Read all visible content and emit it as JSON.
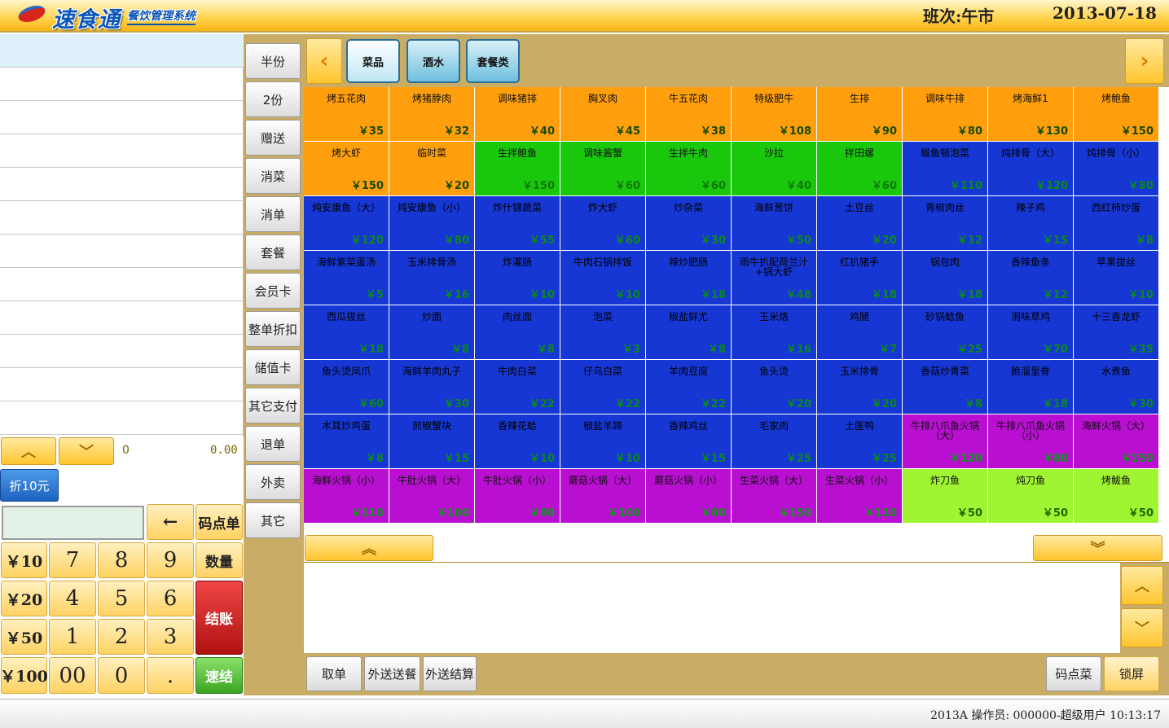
{
  "header": {
    "logo_text": "速食通",
    "logo_sub": "餐饮管理系统",
    "shift": "班次:午市",
    "date": "2013-07-18"
  },
  "summary": {
    "qty": "0",
    "amount": "0.00"
  },
  "discount_label": "折10元",
  "keypad": {
    "back": "←",
    "code_order": "码点单",
    "quantity": "数量",
    "checkout": "结账",
    "quick": "速结",
    "money": [
      "￥10",
      "￥20",
      "￥50",
      "￥100"
    ],
    "digits": [
      "7",
      "8",
      "9",
      "4",
      "5",
      "6",
      "1",
      "2",
      "3",
      "00",
      "0",
      "."
    ]
  },
  "side_buttons": [
    "半份",
    "2份",
    "赠送",
    "消菜",
    "消单",
    "套餐",
    "会员卡",
    "整单折扣",
    "储值卡",
    "其它支付",
    "退单",
    "外卖",
    "其它"
  ],
  "category_tabs": [
    "菜品",
    "酒水",
    "套餐类"
  ],
  "dishes": [
    {
      "name": "烤五花肉",
      "price": "￥35",
      "color": "orange"
    },
    {
      "name": "烤猪脖肉",
      "price": "￥32",
      "color": "orange"
    },
    {
      "name": "调味猪排",
      "price": "￥40",
      "color": "orange"
    },
    {
      "name": "胸叉肉",
      "price": "￥45",
      "color": "orange"
    },
    {
      "name": "牛五花肉",
      "price": "￥38",
      "color": "orange"
    },
    {
      "name": "特级肥牛",
      "price": "￥108",
      "color": "orange"
    },
    {
      "name": "生排",
      "price": "￥90",
      "color": "orange"
    },
    {
      "name": "调味牛排",
      "price": "￥80",
      "color": "orange"
    },
    {
      "name": "烤海鲜1",
      "price": "￥130",
      "color": "orange"
    },
    {
      "name": "烤鲍鱼",
      "price": "￥150",
      "color": "orange"
    },
    {
      "name": "烤大虾",
      "price": "￥150",
      "color": "orange"
    },
    {
      "name": "临时菜",
      "price": "￥20",
      "color": "orange"
    },
    {
      "name": "生拌鲍鱼",
      "price": "￥150",
      "color": "green"
    },
    {
      "name": "调味酱蟹",
      "price": "￥60",
      "color": "green"
    },
    {
      "name": "生拌牛肉",
      "price": "￥60",
      "color": "green"
    },
    {
      "name": "沙拉",
      "price": "￥40",
      "color": "green"
    },
    {
      "name": "拌田螺",
      "price": "￥60",
      "color": "green"
    },
    {
      "name": "鲅鱼顿泡菜",
      "price": "￥110",
      "color": "blue"
    },
    {
      "name": "炖排骨（大）",
      "price": "￥120",
      "color": "blue"
    },
    {
      "name": "炖排骨（小）",
      "price": "￥80",
      "color": "blue"
    },
    {
      "name": "炖安康鱼（大）",
      "price": "￥120",
      "color": "blue"
    },
    {
      "name": "炖安康鱼（小）",
      "price": "￥80",
      "color": "blue"
    },
    {
      "name": "炸什锦蔬菜",
      "price": "￥55",
      "color": "blue"
    },
    {
      "name": "炸大虾",
      "price": "￥60",
      "color": "blue"
    },
    {
      "name": "炒杂菜",
      "price": "￥30",
      "color": "blue"
    },
    {
      "name": "海鲜葱饼",
      "price": "￥50",
      "color": "blue"
    },
    {
      "name": "土豆丝",
      "price": "￥20",
      "color": "blue"
    },
    {
      "name": "青椒肉丝",
      "price": "￥12",
      "color": "blue"
    },
    {
      "name": "辣子鸡",
      "price": "￥15",
      "color": "blue"
    },
    {
      "name": "西红柿炒蛋",
      "price": "￥8",
      "color": "blue"
    },
    {
      "name": "海鲜紫菜蛋汤",
      "price": "￥5",
      "color": "blue"
    },
    {
      "name": "玉米排骨汤",
      "price": "￥16",
      "color": "blue"
    },
    {
      "name": "炸灌肠",
      "price": "￥10",
      "color": "blue"
    },
    {
      "name": "牛肉石锅拌饭",
      "price": "￥10",
      "color": "blue"
    },
    {
      "name": "辣炒肥肠",
      "price": "￥18",
      "color": "blue"
    },
    {
      "name": "雨牛扒配荷兰汁+锅大虾",
      "price": "￥48",
      "color": "blue"
    },
    {
      "name": "红扒猪手",
      "price": "￥18",
      "color": "blue"
    },
    {
      "name": "锅包肉",
      "price": "￥18",
      "color": "blue"
    },
    {
      "name": "香辣鱼条",
      "price": "￥12",
      "color": "blue"
    },
    {
      "name": "苹果拔丝",
      "price": "￥10",
      "color": "blue"
    },
    {
      "name": "西瓜拔丝",
      "price": "￥18",
      "color": "blue"
    },
    {
      "name": "炒面",
      "price": "￥8",
      "color": "blue"
    },
    {
      "name": "肉丝面",
      "price": "￥8",
      "color": "blue"
    },
    {
      "name": "泡菜",
      "price": "￥3",
      "color": "blue"
    },
    {
      "name": "椒盐鲜尤",
      "price": "￥8",
      "color": "blue"
    },
    {
      "name": "玉米烙",
      "price": "￥16",
      "color": "blue"
    },
    {
      "name": "鸡腿",
      "price": "￥7",
      "color": "blue"
    },
    {
      "name": "砂锅鲶鱼",
      "price": "￥25",
      "color": "blue"
    },
    {
      "name": "湘味草鸡",
      "price": "￥70",
      "color": "blue"
    },
    {
      "name": "十三香龙虾",
      "price": "￥35",
      "color": "blue"
    },
    {
      "name": "鱼头烫凤爪",
      "price": "￥60",
      "color": "blue"
    },
    {
      "name": "海鲜羊肉丸子",
      "price": "￥30",
      "color": "blue"
    },
    {
      "name": "牛肉白菜",
      "price": "￥22",
      "color": "blue"
    },
    {
      "name": "仔乌白菜",
      "price": "￥22",
      "color": "blue"
    },
    {
      "name": "羊肉豆腐",
      "price": "￥22",
      "color": "blue"
    },
    {
      "name": "鱼头烫",
      "price": "￥20",
      "color": "blue"
    },
    {
      "name": "玉米排骨",
      "price": "￥20",
      "color": "blue"
    },
    {
      "name": "香菇炒青菜",
      "price": "￥8",
      "color": "blue"
    },
    {
      "name": "脆溜里脊",
      "price": "￥18",
      "color": "blue"
    },
    {
      "name": "水煮鱼",
      "price": "￥30",
      "color": "blue"
    },
    {
      "name": "木耳炒鸡蛋",
      "price": "￥8",
      "color": "blue"
    },
    {
      "name": "煎椒蟹块",
      "price": "￥15",
      "color": "blue"
    },
    {
      "name": "香辣花蛤",
      "price": "￥10",
      "color": "blue"
    },
    {
      "name": "椒盐羊蹄",
      "price": "￥10",
      "color": "blue"
    },
    {
      "name": "香辣鸡丝",
      "price": "￥15",
      "color": "blue"
    },
    {
      "name": "毛家肉",
      "price": "￥25",
      "color": "blue"
    },
    {
      "name": "土匪鸭",
      "price": "￥25",
      "color": "blue"
    },
    {
      "name": "牛排八爪鱼火锅（大）",
      "price": "￥120",
      "color": "purple"
    },
    {
      "name": "牛排八爪鱼火锅（小）",
      "price": "￥80",
      "color": "purple"
    },
    {
      "name": "海鲜火锅（大）",
      "price": "￥150",
      "color": "purple"
    },
    {
      "name": "海鲜火锅（小）",
      "price": "￥110",
      "color": "purple"
    },
    {
      "name": "牛肚火锅（大）",
      "price": "￥100",
      "color": "purple"
    },
    {
      "name": "牛肚火锅（小）",
      "price": "￥80",
      "color": "purple"
    },
    {
      "name": "蘑菇火锅（大）",
      "price": "￥100",
      "color": "purple"
    },
    {
      "name": "蘑菇火锅（小）",
      "price": "￥80",
      "color": "purple"
    },
    {
      "name": "生菜火锅（大）",
      "price": "￥150",
      "color": "purple"
    },
    {
      "name": "生菜火锅（小）",
      "price": "￥110",
      "color": "purple"
    },
    {
      "name": "炸刀鱼",
      "price": "￥50",
      "color": "lime"
    },
    {
      "name": "炖刀鱼",
      "price": "￥50",
      "color": "lime"
    },
    {
      "name": "烤鲅鱼",
      "price": "￥50",
      "color": "lime"
    }
  ],
  "bottom_buttons": {
    "take_order": "取单",
    "delivery_send": "外送送餐",
    "delivery_settle": "外送结算",
    "code_dish": "码点菜",
    "lock_screen": "锁屏"
  },
  "status": {
    "text": "2013A 操作员: 000000-超级用户  10:13:17"
  },
  "colors": {
    "orange": "#ff9f0d",
    "green": "#19c80d",
    "blue": "#1637d4",
    "purple": "#b80fd0",
    "lime": "#9ff531",
    "panel": "#c9ad66"
  }
}
